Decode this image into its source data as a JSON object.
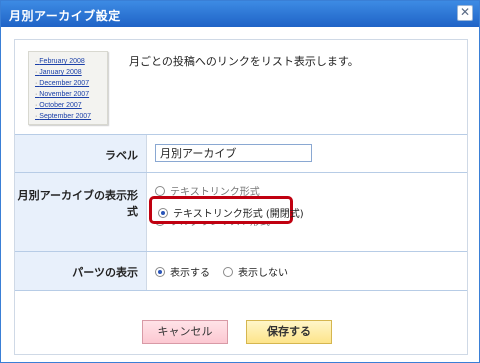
{
  "dialog": {
    "title": "月別アーカイブ設定",
    "close_label": "✕"
  },
  "preview": {
    "items": [
      "February 2008",
      "January 2008",
      "December 2007",
      "November 2007",
      "October 2007",
      "September 2007"
    ]
  },
  "description": "月ごとの投稿へのリンクをリスト表示します。",
  "form": {
    "label_row": {
      "label": "ラベル",
      "value": "月別アーカイブ"
    },
    "display_format_row": {
      "label": "月別アーカイブの表示形式",
      "options": [
        {
          "label": "テキストリンク形式",
          "selected": false
        },
        {
          "label": "テキストリンク形式 (開閉式)",
          "selected": true
        },
        {
          "label": "プルダウンリスト形式",
          "selected": false
        }
      ]
    },
    "parts_row": {
      "label": "パーツの表示",
      "options": [
        {
          "label": "表示する",
          "selected": true
        },
        {
          "label": "表示しない",
          "selected": false
        }
      ]
    }
  },
  "buttons": {
    "cancel": "キャンセル",
    "save": "保存する"
  },
  "colors": {
    "titlebar": "#1f63c6",
    "label_bg": "#e8f0fb",
    "highlight": "#c00010",
    "cancel_bg": "#fcc8d2",
    "save_bg": "#fde48a"
  }
}
